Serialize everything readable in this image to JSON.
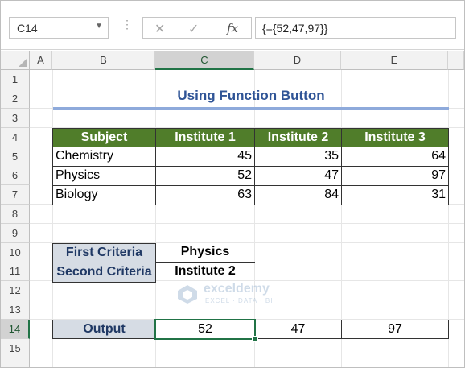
{
  "formula_bar": {
    "name_box": "C14",
    "formula": "{={52,47,97}}",
    "fx_label": "fx"
  },
  "columns": [
    "A",
    "B",
    "C",
    "D",
    "E"
  ],
  "rows": [
    "1",
    "2",
    "3",
    "4",
    "5",
    "6",
    "7",
    "8",
    "9",
    "10",
    "11",
    "12",
    "13",
    "14",
    "15"
  ],
  "selected": {
    "column": "C",
    "row": "14"
  },
  "sheet": {
    "title": "Using Function Button",
    "table": {
      "headers": [
        "Subject",
        "Institute 1",
        "Institute 2",
        "Institute 3"
      ],
      "rows": [
        {
          "subject": "Chemistry",
          "values": [
            "45",
            "35",
            "64"
          ]
        },
        {
          "subject": "Physics",
          "values": [
            "52",
            "47",
            "97"
          ]
        },
        {
          "subject": "Biology",
          "values": [
            "63",
            "84",
            "31"
          ]
        }
      ]
    },
    "criteria": {
      "first_label": "First Criteria",
      "first_value": "Physics",
      "second_label": "Second Criteria",
      "second_value": "Institute 2"
    },
    "output": {
      "label": "Output",
      "values": [
        "52",
        "47",
        "97"
      ]
    }
  },
  "watermark": {
    "name": "exceldemy",
    "tagline": "EXCEL · DATA · BI"
  },
  "colors": {
    "header_green": "#507d2a",
    "criteria_fill": "#d6dce4",
    "title_blue": "#2f5496",
    "selection_green": "#217346"
  }
}
